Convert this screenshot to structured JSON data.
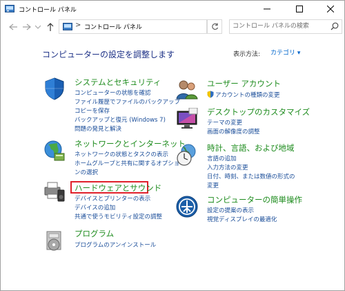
{
  "window": {
    "title": "コントロール パネル"
  },
  "address": {
    "crumb": "コントロール パネル",
    "separator": ">"
  },
  "search": {
    "placeholder": "コントロール パネルの検索"
  },
  "main": {
    "heading": "コンピューターの設定を調整します",
    "view_by_label": "表示方法:",
    "view_by_value": "カテゴリ ▾"
  },
  "categories": {
    "system": {
      "title": "システムとセキュリティ",
      "links": [
        "コンピューターの状態を確認",
        "ファイル履歴でファイルのバックアップ",
        "コピーを保存",
        "バックアップと復元 (Windows 7)",
        "問題の発見と解決"
      ]
    },
    "network": {
      "title": "ネットワークとインターネット",
      "links": [
        "ネットワークの状態とタスクの表示",
        "ホームグループと共有に関するオプショ",
        "ンの選択"
      ]
    },
    "hardware": {
      "title": "ハードウェアとサウンド",
      "links": [
        "デバイスとプリンターの表示",
        "デバイスの追加",
        "共通で使うモビリティ設定の調整"
      ]
    },
    "programs": {
      "title": "プログラム",
      "links": [
        "プログラムのアンインストール"
      ]
    },
    "users": {
      "title": "ユーザー アカウント",
      "links": [
        "アカウントの種類の変更"
      ]
    },
    "appearance": {
      "title": "デスクトップのカスタマイズ",
      "links": [
        "テーマの変更",
        "画面の解像度の調整"
      ]
    },
    "clock": {
      "title": "時計、言語、および地域",
      "links": [
        "言語の追加",
        "入力方法の変更",
        "日付、時刻、または数値の形式の",
        "変更"
      ]
    },
    "ease": {
      "title": "コンピューターの簡単操作",
      "links": [
        "設定の提案の表示",
        "視覚ディスプレイの最適化"
      ]
    }
  }
}
